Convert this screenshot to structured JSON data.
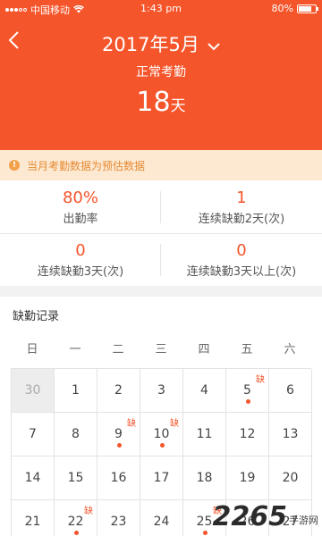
{
  "status_bar": {
    "carrier": "中国移动",
    "time": "1:43 pm",
    "battery": "80%",
    "battery_level": 0.8
  },
  "header": {
    "month": "2017年5月",
    "subtitle": "正常考勤",
    "days_value": "18",
    "days_unit": "天",
    "accent_color": "#f5552b"
  },
  "notice": {
    "text": "当月考勤数据为预估数据"
  },
  "stats": [
    {
      "value": "80%",
      "label": "出勤率"
    },
    {
      "value": "1",
      "label": "连续缺勤2天(次)"
    },
    {
      "value": "0",
      "label": "连续缺勤3天(次)"
    },
    {
      "value": "0",
      "label": "连续缺勤3天以上(次)"
    }
  ],
  "record": {
    "title": "缺勤记录",
    "weekdays": [
      "日",
      "一",
      "二",
      "三",
      "四",
      "五",
      "六"
    ],
    "absent_tag": "缺",
    "days": [
      {
        "label": "30",
        "muted": true
      },
      {
        "label": "1"
      },
      {
        "label": "2"
      },
      {
        "label": "3"
      },
      {
        "label": "4"
      },
      {
        "label": "5",
        "absent": true
      },
      {
        "label": "6"
      },
      {
        "label": "7"
      },
      {
        "label": "8"
      },
      {
        "label": "9",
        "absent": true
      },
      {
        "label": "10",
        "absent": true
      },
      {
        "label": "11"
      },
      {
        "label": "12"
      },
      {
        "label": "13"
      },
      {
        "label": "14"
      },
      {
        "label": "15"
      },
      {
        "label": "16"
      },
      {
        "label": "17"
      },
      {
        "label": "18"
      },
      {
        "label": "19"
      },
      {
        "label": "20"
      },
      {
        "label": "21"
      },
      {
        "label": "22",
        "absent": true
      },
      {
        "label": "23"
      },
      {
        "label": "24"
      },
      {
        "label": "25",
        "absent": true
      },
      {
        "label": "26"
      },
      {
        "label": "27"
      }
    ]
  },
  "watermark": {
    "number": "2265",
    "text": "手游网"
  }
}
